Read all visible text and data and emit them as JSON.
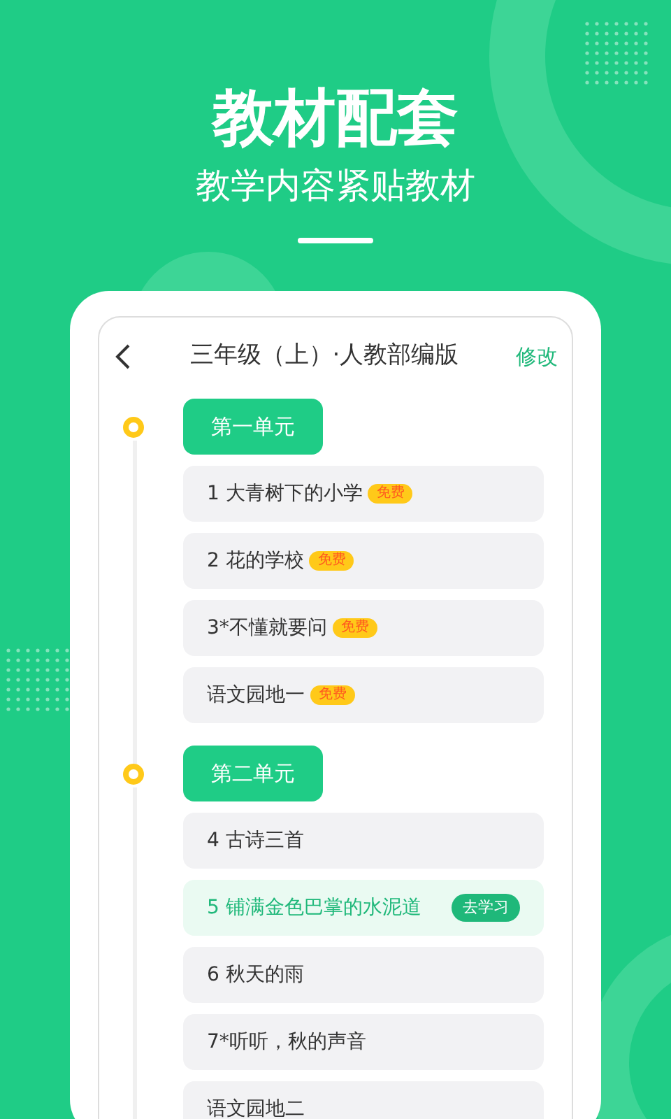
{
  "headline": "教材配套",
  "subtitle": "教学内容紧贴教材",
  "screen": {
    "title": "三年级（上）·人教部编版",
    "edit": "修改",
    "units": [
      {
        "name": "第一单元",
        "lessons": [
          {
            "title": "1 大青树下的小学",
            "badge": "免费",
            "selected": false
          },
          {
            "title": "2 花的学校",
            "badge": "免费",
            "selected": false
          },
          {
            "title": "3*不懂就要问",
            "badge": "免费",
            "selected": false
          },
          {
            "title": "语文园地一",
            "badge": "免费",
            "selected": false
          }
        ]
      },
      {
        "name": "第二单元",
        "lessons": [
          {
            "title": "4 古诗三首",
            "selected": false
          },
          {
            "title": "5 铺满金色巴掌的水泥道",
            "action": "去学习",
            "selected": true
          },
          {
            "title": "6 秋天的雨",
            "selected": false
          },
          {
            "title": "7*听听，秋的声音",
            "selected": false
          },
          {
            "title": "语文园地二",
            "selected": false
          }
        ]
      }
    ]
  }
}
